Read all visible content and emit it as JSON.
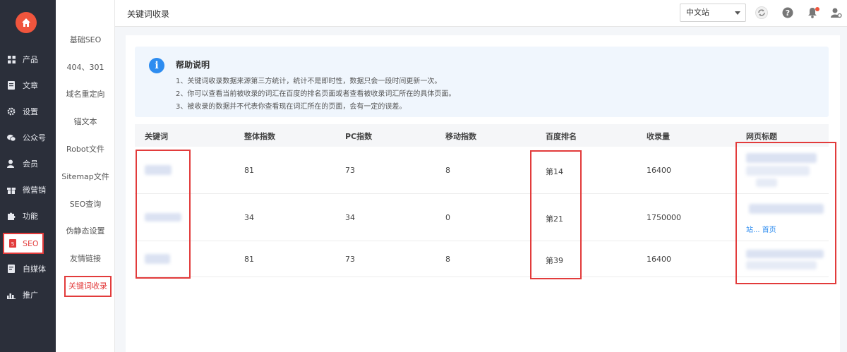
{
  "rail": {
    "items": [
      {
        "label": "产品",
        "icon": "grid-icon"
      },
      {
        "label": "文章",
        "icon": "document-icon"
      },
      {
        "label": "设置",
        "icon": "gear-icon"
      },
      {
        "label": "公众号",
        "icon": "wechat-icon"
      },
      {
        "label": "会员",
        "icon": "user-icon"
      },
      {
        "label": "微营销",
        "icon": "gift-icon"
      },
      {
        "label": "功能",
        "icon": "puzzle-icon"
      },
      {
        "label": "SEO",
        "icon": "seo-icon"
      },
      {
        "label": "自媒体",
        "icon": "media-icon"
      },
      {
        "label": "推广",
        "icon": "chart-icon"
      }
    ],
    "active": "SEO"
  },
  "submenu": {
    "items": [
      "基础SEO",
      "404、301",
      "域名重定向",
      "锚文本",
      "Robot文件",
      "Sitemap文件",
      "SEO查询",
      "伪静态设置",
      "友情链接",
      "关键词收录"
    ],
    "active": "关键词收录"
  },
  "topbar": {
    "title": "关键词收录",
    "site_select": "中文站"
  },
  "help": {
    "title": "帮助说明",
    "lines": [
      "1、关键词收录数据来源第三方统计，统计不是即时性，数据只会一段时间更新一次。",
      "2、你可以查看当前被收录的词汇在百度的排名页面或者查看被收录词汇所在的具体页面。",
      "3、被收录的数据并不代表你查看现在词汇所在的页面，会有一定的误差。"
    ]
  },
  "table": {
    "headers": [
      "关键词",
      "整体指数",
      "PC指数",
      "移动指数",
      "百度排名",
      "收录量",
      "网页标题"
    ],
    "rows": [
      {
        "overall": "81",
        "pc": "73",
        "mobile": "8",
        "rank": "第14",
        "indexed": "16400",
        "title_link": ""
      },
      {
        "overall": "34",
        "pc": "34",
        "mobile": "0",
        "rank": "第21",
        "indexed": "1750000",
        "title_link": "站... 首页"
      },
      {
        "overall": "81",
        "pc": "73",
        "mobile": "8",
        "rank": "第39",
        "indexed": "16400",
        "title_link": ""
      }
    ]
  },
  "colors": {
    "rail_bg": "#2b2f3a",
    "accent_red": "#e23b3b",
    "home_orange": "#f0553d",
    "info_blue": "#2d8cf0"
  }
}
